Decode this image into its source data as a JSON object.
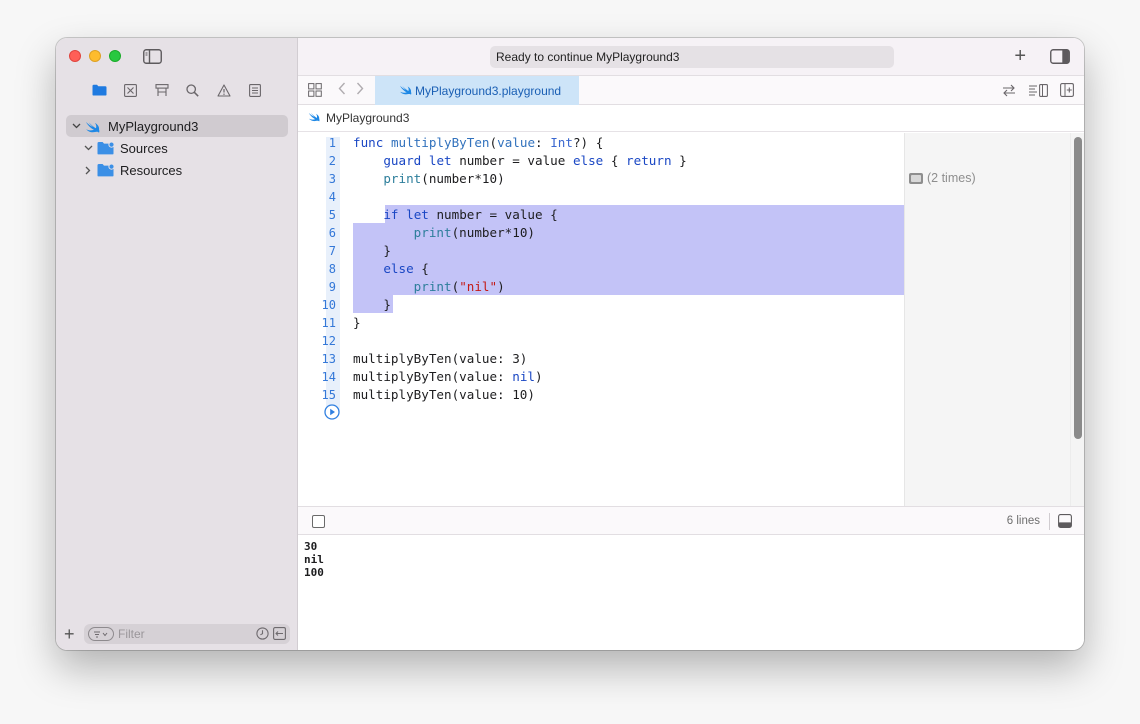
{
  "window": {
    "activity_status": "Ready to continue MyPlayground3"
  },
  "navigator": {
    "tabs": [
      "project-navigator",
      "source-control",
      "symbol",
      "find",
      "issue",
      "test"
    ],
    "tree": [
      {
        "label": "MyPlayground3",
        "expanded": true,
        "selected": true,
        "icon": "swift-icon"
      },
      {
        "label": "Sources",
        "expanded": true,
        "icon": "folder-icon"
      },
      {
        "label": "Resources",
        "expanded": false,
        "icon": "folder-icon"
      }
    ],
    "filter_placeholder": "Filter"
  },
  "editor": {
    "tab_label": "MyPlayground3.playground",
    "breadcrumb": "MyPlayground3",
    "line_numbers": [
      "1",
      "2",
      "3",
      "4",
      "5",
      "6",
      "7",
      "8",
      "9",
      "10",
      "11",
      "12",
      "13",
      "14",
      "15"
    ],
    "result_text": "(2 times)"
  },
  "console": {
    "lines_count": "6 lines",
    "output": [
      "30",
      "nil",
      "100"
    ]
  },
  "colors": {
    "selection": "#c3c3f7",
    "keyword": "#1a47c4",
    "string": "#c41a16",
    "line_number": "#3478d8",
    "active_tab": "#cde4f8"
  }
}
